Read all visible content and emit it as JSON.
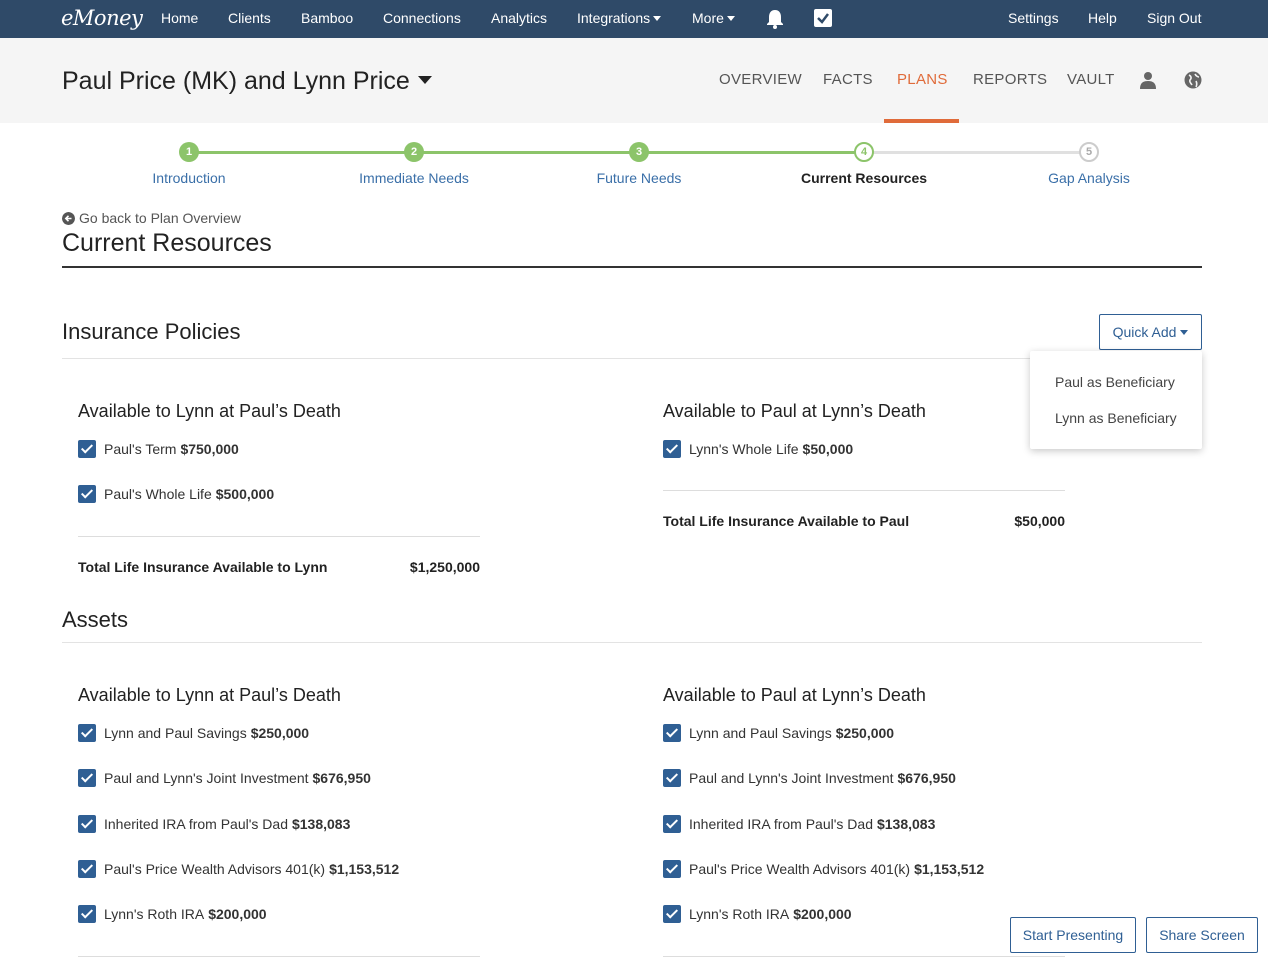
{
  "topnav": {
    "logo": "eMoney",
    "items": [
      "Home",
      "Clients",
      "Bamboo",
      "Connections",
      "Analytics",
      "Integrations",
      "More"
    ],
    "right": [
      "Settings",
      "Help",
      "Sign Out"
    ]
  },
  "client": {
    "name": "Paul Price (MK) and Lynn Price",
    "tabs": [
      "OVERVIEW",
      "FACTS",
      "PLANS",
      "REPORTS",
      "VAULT"
    ],
    "active_tab": "PLANS"
  },
  "stepper": {
    "steps": [
      {
        "num": "1",
        "label": "Introduction",
        "state": "done"
      },
      {
        "num": "2",
        "label": "Immediate Needs",
        "state": "done"
      },
      {
        "num": "3",
        "label": "Future Needs",
        "state": "done"
      },
      {
        "num": "4",
        "label": "Current Resources",
        "state": "current"
      },
      {
        "num": "5",
        "label": "Gap Analysis",
        "state": "future"
      }
    ]
  },
  "page": {
    "back_link": "Go back to Plan Overview",
    "title": "Current Resources"
  },
  "insurance": {
    "title": "Insurance Policies",
    "quick_add": "Quick Add",
    "dropdown": [
      "Paul as Beneficiary",
      "Lynn as Beneficiary"
    ],
    "left": {
      "heading": "Available to Lynn at Paul’s Death",
      "items": [
        {
          "label": "Paul's Term",
          "value": "$750,000"
        },
        {
          "label": "Paul's Whole Life",
          "value": "$500,000"
        }
      ],
      "total_label": "Total Life Insurance Available to Lynn",
      "total_value": "$1,250,000"
    },
    "right": {
      "heading": "Available to Paul at Lynn’s Death",
      "items": [
        {
          "label": "Lynn's Whole Life",
          "value": "$50,000"
        }
      ],
      "total_label": "Total Life Insurance Available to Paul",
      "total_value": "$50,000"
    }
  },
  "assets": {
    "title": "Assets",
    "left": {
      "heading": "Available to Lynn at Paul’s Death",
      "items": [
        {
          "label": "Lynn and Paul Savings",
          "value": "$250,000"
        },
        {
          "label": "Paul and Lynn's Joint Investment",
          "value": "$676,950"
        },
        {
          "label": "Inherited IRA from Paul's Dad",
          "value": "$138,083"
        },
        {
          "label": "Paul's Price Wealth Advisors 401(k)",
          "value": "$1,153,512"
        },
        {
          "label": "Lynn's Roth IRA",
          "value": "$200,000"
        }
      ]
    },
    "right": {
      "heading": "Available to Paul at Lynn’s Death",
      "items": [
        {
          "label": "Lynn and Paul Savings",
          "value": "$250,000"
        },
        {
          "label": "Paul and Lynn's Joint Investment",
          "value": "$676,950"
        },
        {
          "label": "Inherited IRA from Paul's Dad",
          "value": "$138,083"
        },
        {
          "label": "Paul's Price Wealth Advisors 401(k)",
          "value": "$1,153,512"
        },
        {
          "label": "Lynn's Roth IRA",
          "value": "$200,000"
        }
      ]
    }
  },
  "floating": {
    "start_presenting": "Start Presenting",
    "share_screen": "Share Screen"
  }
}
